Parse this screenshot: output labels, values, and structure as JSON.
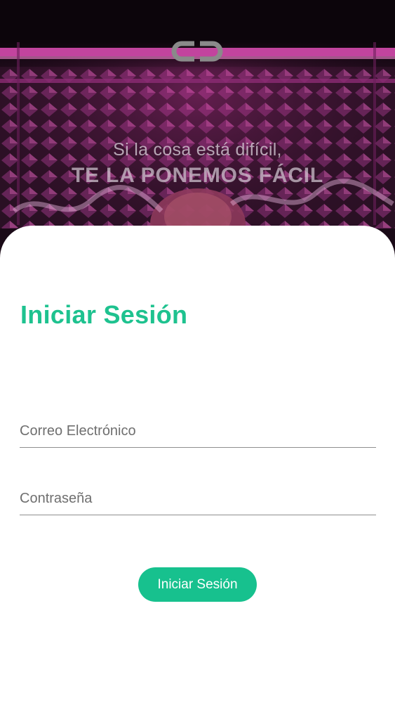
{
  "hero": {
    "logo_icon": "cc-logo-icon",
    "tagline_line1": "Si la cosa está difícil,",
    "tagline_line2": "TE LA PONEMOS FÁCIL"
  },
  "login": {
    "title": "Iniciar Sesión",
    "email": {
      "value": "",
      "placeholder": "Correo Electrónico"
    },
    "password": {
      "value": "",
      "placeholder": "Contraseña"
    },
    "submit_label": "Iniciar Sesión"
  },
  "colors": {
    "accent": "#1ec28f",
    "button": "#17c18e",
    "hero_dark": "#150912",
    "hero_magenta": "#c23a9a"
  }
}
